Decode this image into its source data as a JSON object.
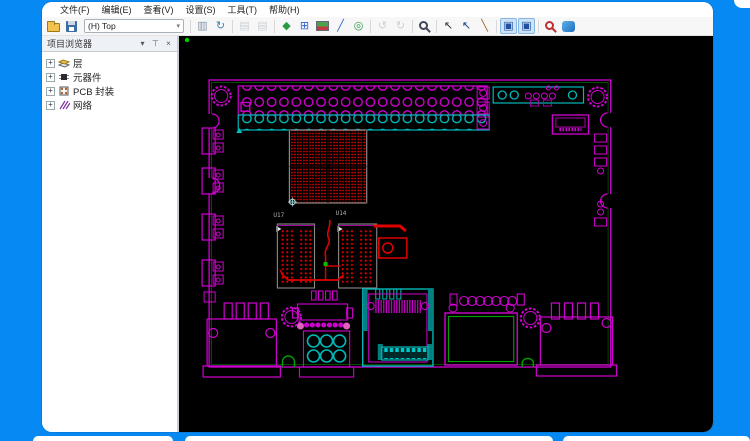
{
  "frame": {
    "background_color": "#0689f2"
  },
  "menu": {
    "items": [
      {
        "label": "文件(F)"
      },
      {
        "label": "编辑(E)"
      },
      {
        "label": "查看(V)"
      },
      {
        "label": "设置(S)"
      },
      {
        "label": "工具(T)"
      },
      {
        "label": "帮助(H)"
      }
    ]
  },
  "toolbar": {
    "layer_select": {
      "value": "(H) Top",
      "arrow_glyph": "▾"
    },
    "buttons": [
      {
        "name": "open",
        "glyph": ""
      },
      {
        "name": "save",
        "glyph": ""
      },
      {
        "name": "attach-file",
        "glyph": "▥"
      },
      {
        "name": "refresh",
        "glyph": "↻"
      },
      {
        "name": "prev-view",
        "glyph": "▤",
        "state": "disabled"
      },
      {
        "name": "next-view",
        "glyph": "▤",
        "state": "disabled"
      },
      {
        "name": "place-component",
        "glyph": "◆"
      },
      {
        "name": "grid-settings",
        "glyph": "⊞"
      },
      {
        "name": "layer-colors",
        "glyph": ""
      },
      {
        "name": "draw-line",
        "glyph": "╱"
      },
      {
        "name": "find-component",
        "glyph": "◎"
      },
      {
        "name": "undo",
        "glyph": "↺",
        "state": "disabled"
      },
      {
        "name": "redo",
        "glyph": "↻",
        "state": "disabled"
      },
      {
        "name": "zoom",
        "glyph": ""
      },
      {
        "name": "select-pointer",
        "glyph": "↖"
      },
      {
        "name": "select-net",
        "glyph": "↖"
      },
      {
        "name": "highlight-brush",
        "glyph": "╲"
      },
      {
        "name": "view-window",
        "glyph": "▣",
        "state": "active"
      },
      {
        "name": "view-board",
        "glyph": "▣",
        "state": "active"
      },
      {
        "name": "zoom-highlight",
        "glyph": ""
      },
      {
        "name": "cross-probe",
        "glyph": ""
      }
    ]
  },
  "sidebar": {
    "title": "项目浏览器",
    "controls": [
      {
        "name": "panel-menu",
        "glyph": "▾"
      },
      {
        "name": "panel-pin",
        "glyph": "⊤"
      },
      {
        "name": "panel-close",
        "glyph": "×"
      }
    ],
    "expander_glyph": "+",
    "tree": [
      {
        "label": "层"
      },
      {
        "label": "元器件"
      },
      {
        "label": "PCB 封装"
      },
      {
        "label": "网络"
      }
    ]
  },
  "canvas": {
    "component_labels": {
      "u17": "U17",
      "u14": "U14"
    },
    "colors": {
      "background": "#000000",
      "silkscreen_magenta": "#d000d0",
      "pad_red": "#e00000",
      "layer_cyan": "#00b0b0",
      "board_green": "#00a000",
      "outline_gray": "#8a8a8a"
    }
  }
}
